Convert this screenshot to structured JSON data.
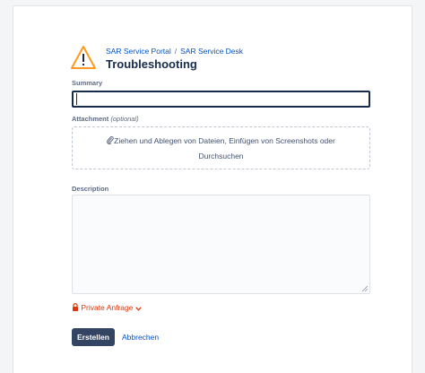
{
  "header": {
    "icon": "warning-triangle-icon",
    "breadcrumbs": [
      "SAR Service Portal",
      "SAR Service Desk"
    ],
    "separator": "/",
    "title": "Troubleshooting"
  },
  "form": {
    "summary": {
      "label": "Summary",
      "value": ""
    },
    "attachment": {
      "label": "Attachment",
      "optional_text": "(optional)",
      "icon": "paperclip-icon",
      "drop_text_line1": "Ziehen und Ablegen von Dateien, Einfügen von Screenshots oder",
      "drop_text_line2": "Durchsuchen"
    },
    "description": {
      "label": "Description",
      "value": ""
    },
    "privacy": {
      "label": "Private Anfrage",
      "icon": "lock-icon",
      "accent": "#de350b"
    },
    "actions": {
      "submit": "Erstellen",
      "cancel": "Abbrechen"
    }
  },
  "colors": {
    "primary_button": "#344563",
    "link": "#0052cc",
    "warning_icon": "#ff991f"
  }
}
